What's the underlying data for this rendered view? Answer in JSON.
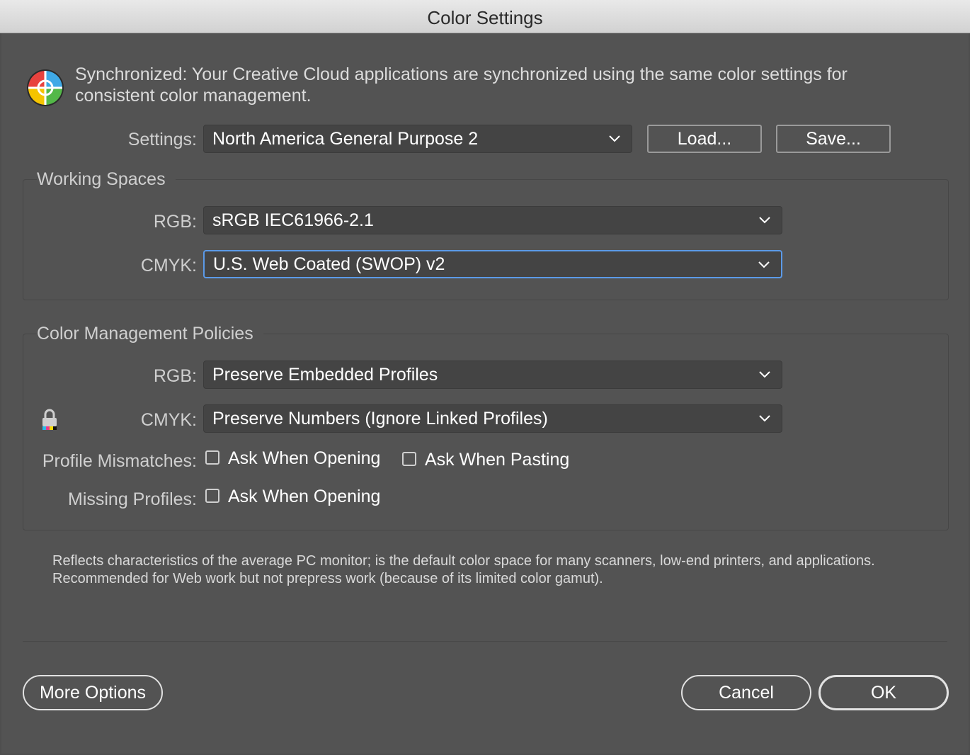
{
  "window": {
    "title": "Color Settings"
  },
  "sync": {
    "icon": "color-wheel-icon",
    "text": "Synchronized: Your Creative Cloud applications are synchronized using the same color settings for consistent color management."
  },
  "settings": {
    "label": "Settings:",
    "value": "North America General Purpose 2",
    "load_label": "Load...",
    "save_label": "Save..."
  },
  "working_spaces": {
    "title": "Working Spaces",
    "rgb_label": "RGB:",
    "rgb_value": "sRGB IEC61966-2.1",
    "cmyk_label": "CMYK:",
    "cmyk_value": "U.S. Web Coated (SWOP) v2"
  },
  "policies": {
    "title": "Color Management Policies",
    "rgb_label": "RGB:",
    "rgb_value": "Preserve Embedded Profiles",
    "cmyk_label": "CMYK:",
    "cmyk_value": "Preserve Numbers (Ignore Linked Profiles)",
    "mismatch_label": "Profile Mismatches:",
    "mismatch_opening": "Ask When Opening",
    "mismatch_pasting": "Ask When Pasting",
    "missing_label": "Missing Profiles:",
    "missing_opening": "Ask When Opening",
    "checkboxes": {
      "mismatch_opening": false,
      "mismatch_pasting": false,
      "missing_opening": false
    }
  },
  "description": "Reflects characteristics of the average PC monitor; is the default color space for many scanners, low-end printers, and applications. Recommended for Web work but not prepress work (because of its limited color gamut).",
  "footer": {
    "more_options": "More Options",
    "cancel": "Cancel",
    "ok": "OK"
  },
  "colors": {
    "accent": "#5b9ae8",
    "panel": "#535353",
    "field": "#444444"
  }
}
